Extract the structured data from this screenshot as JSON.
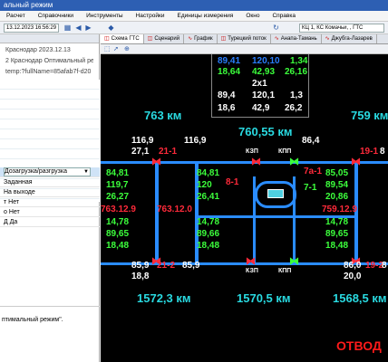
{
  "window": {
    "title": "альный режим"
  },
  "menu": [
    "Расчет",
    "Справочники",
    "Инструменты",
    "Настройки",
    "Единицы измерения",
    "Окно",
    "Справка"
  ],
  "toolbar": {
    "datetime": "13.12.2023 16:56:29",
    "combo": "КЦ 1, КС Комачьи, , ГТС"
  },
  "left": {
    "info": [
      "Краснодар 2023.12.13",
      "2 Краснодар Оптимальный ре",
      "temp:?fullName=85afab7f-d20"
    ],
    "props": [
      {
        "label": "Дозагрузка/разгрузка",
        "combo": true
      },
      {
        "label": "Заданная"
      },
      {
        "label": "На выходе"
      },
      {
        "label": "т Нет"
      },
      {
        "label": "о Нет"
      },
      {
        "label": "Д Да"
      }
    ],
    "status": "птимальный режим\"."
  },
  "tabs": [
    "Схема ГТС",
    "Сценарий",
    "График",
    "Турецкий поток",
    "Анапа-Тамань",
    "Джубга-Лазарев"
  ],
  "scheme": {
    "top_table": {
      "rows": [
        [
          "89,41",
          "120,10",
          "1,34"
        ],
        [
          "18,64",
          "42,93",
          "26,16"
        ]
      ],
      "mid": "2x1",
      "rows2": [
        [
          "89,4",
          "120,1",
          "1,3"
        ],
        [
          "18,6",
          "42,9",
          "26,2"
        ]
      ]
    },
    "km_left": "763 км",
    "km_center": "760,55 км",
    "km_right": "759 км",
    "km_bl": "1572,3 км",
    "km_bc": "1570,5 км",
    "km_br": "1568,5 км",
    "top_left": {
      "a": "116,9",
      "b": "27,1",
      "c": "116,9",
      "id": "21-1"
    },
    "top_mid": "86,4",
    "top_right": {
      "id": "19-1",
      "a": "8"
    },
    "gl": [
      "84,81",
      "119,7",
      "26,27"
    ],
    "gl2": [
      "84,81",
      "120",
      "26,41"
    ],
    "gr": [
      "85,05",
      "89,54",
      "20,86"
    ],
    "red_left": "763.12.9",
    "red_left2": "763.12.0",
    "red_right": "759.12.9",
    "lower_left": [
      "14,78",
      "89,65",
      "18,48"
    ],
    "lower_left2": [
      "14,78",
      "89,66",
      "18,48"
    ],
    "lower_right": [
      "14,78",
      "89,65",
      "18,48"
    ],
    "u81": "8-1",
    "u71": "7-1",
    "u7a": "7а-1",
    "kzp1": "КЗП",
    "kpp1": "КПП",
    "kzp2": "КЗП",
    "kpp2": "КПП",
    "bot_left": {
      "a": "85,9",
      "id": "21-2",
      "b": "85,9",
      "c": "18,8"
    },
    "bot_right": {
      "a": "86,0",
      "id": "19-2",
      "b": "8",
      "c": "20,0"
    },
    "warn": "ОТВОД"
  }
}
